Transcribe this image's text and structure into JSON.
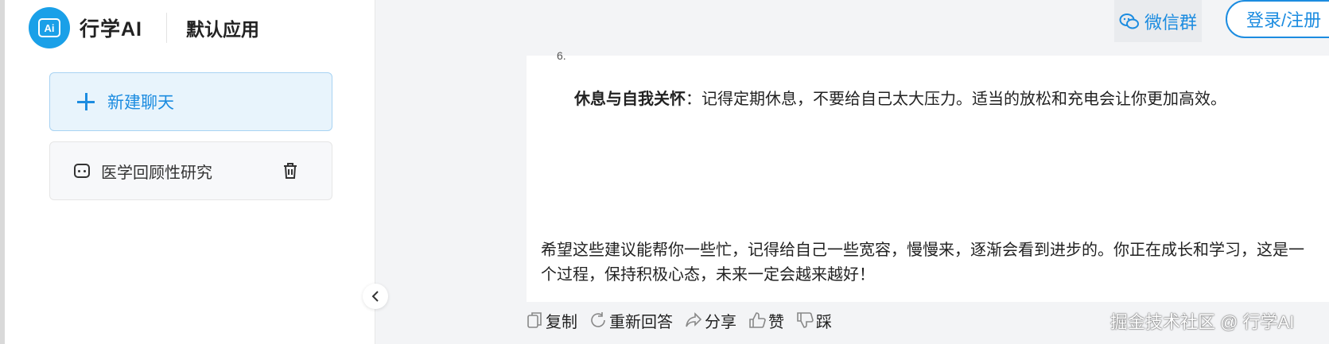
{
  "sidebar": {
    "brand_logo_text": "Ai",
    "brand_name": "行学AI",
    "app_name": "默认应用",
    "new_chat_label": "新建聊天",
    "chats": [
      {
        "title": "医学回顾性研究"
      }
    ]
  },
  "header": {
    "wechat_group_label": "微信群",
    "login_label": "登录/注册"
  },
  "message": {
    "list_marker": "6.",
    "point_title": "休息与自我关怀",
    "point_text": "：记得定期休息，不要给自己太大压力。适当的放松和充电会让你更加高效。",
    "closing": "希望这些建议能帮你一些忙，记得给自己一些宽容，慢慢来，逐渐会看到进步的。你正在成长和学习，这是一个过程，保持积极心态，未来一定会越来越好！"
  },
  "actions": {
    "copy": "复制",
    "regenerate": "重新回答",
    "share": "分享",
    "like": "赞",
    "dislike": "踩"
  },
  "watermark": "掘金技术社区 @ 行学AI",
  "colors": {
    "accent": "#1c8ce0",
    "logo_bg": "#1aa0e8",
    "new_chat_bg": "#e8f4fc",
    "page_bg": "#f3f4f6"
  }
}
